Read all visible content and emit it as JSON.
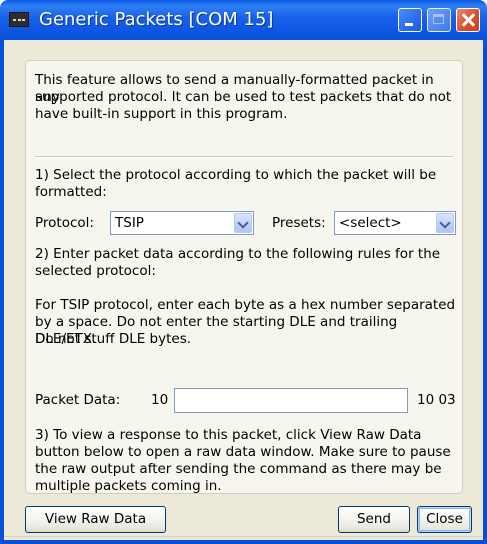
{
  "window": {
    "title": "Generic Packets [COM 15]",
    "app_icon": "terminal-icon",
    "controls": [
      "minimize-icon",
      "maximize-icon",
      "close-icon"
    ]
  },
  "intro": {
    "line1": "This feature allows to send a manually-formatted packet in any",
    "line2": "supported protocol. It can be used to test packets that do not",
    "line3": "have built-in support in this program."
  },
  "step1": {
    "line1": "1) Select the protocol according to which the packet will be",
    "line2": "formatted:"
  },
  "protocol": {
    "label": "Protocol:",
    "value": "TSIP"
  },
  "presets": {
    "label": "Presets:",
    "value": "<select>"
  },
  "step2": {
    "line1": "2) Enter packet data according to the following rules for the",
    "line2": "selected protocol:"
  },
  "rules": {
    "line1": "For TSIP protocol, enter each byte as a hex number separated",
    "line2": "by a space. Do not enter the starting DLE and trailing DLE/ETX.",
    "line3": "Do not stuff DLE bytes."
  },
  "packet": {
    "label": "Packet Data:",
    "prefix": "10",
    "value": "",
    "suffix": "10 03"
  },
  "step3": {
    "line1": "3) To view a response to this packet, click View Raw Data",
    "line2": "button below to open a raw data window. Make sure to pause",
    "line3": "the raw output after sending the command as there may be",
    "line4": "multiple packets coming in."
  },
  "buttons": {
    "view_raw": "View Raw Data",
    "send": "Send",
    "close": "Close"
  },
  "colors": {
    "titlebar": "#0a53e0",
    "dialog_bg": "#ece9d8",
    "group_bg": "#f7f6ee",
    "close_button": "#d8542f"
  }
}
